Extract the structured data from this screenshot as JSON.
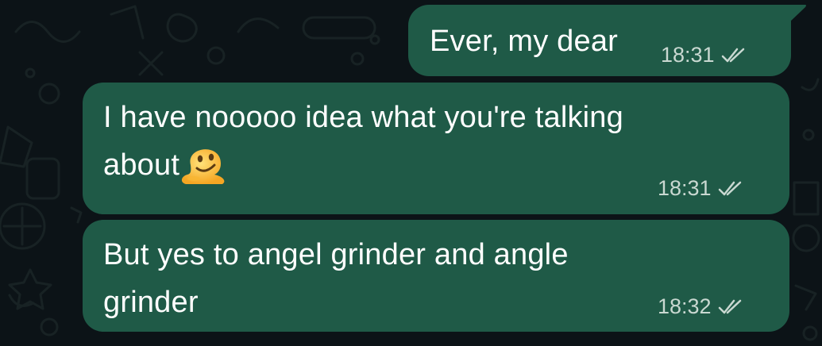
{
  "messages": [
    {
      "text": "Ever, my dear",
      "time": "18:31",
      "status": "read"
    },
    {
      "text_line1": "I have nooooo idea what you're talking",
      "text_line2": "about",
      "emoji": "melting-face-emoji",
      "time": "18:31",
      "status": "read"
    },
    {
      "text_line1": "But yes to angel grinder and angle",
      "text_line2": "grinder",
      "time": "18:32",
      "status": "read"
    }
  ],
  "colors": {
    "background": "#0c1317",
    "bubble": "#1f5a47",
    "text": "#ffffff",
    "meta": "#c9d8d1"
  }
}
